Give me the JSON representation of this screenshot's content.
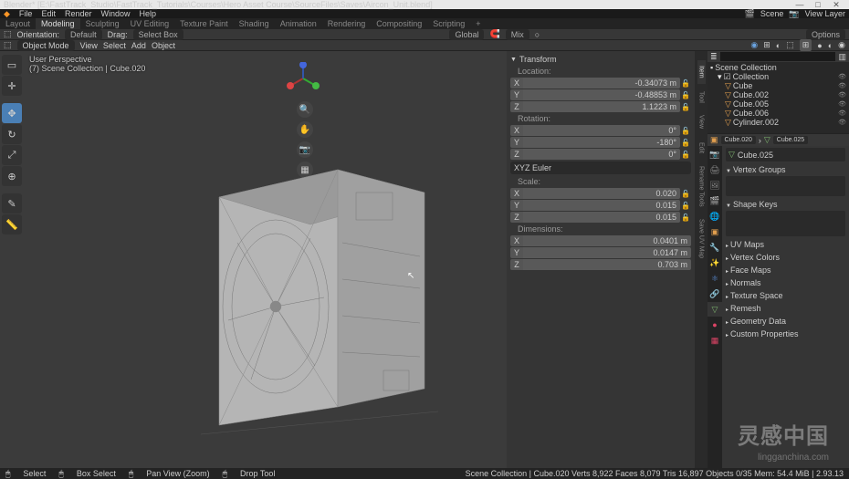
{
  "titlebar": {
    "title": "Blender* [E:\\FastTrack_Studio\\FastTrack_Tutorials\\Courses\\Hero Asset Course\\SourceFiles\\Saves\\Aircon_Unit.blend]"
  },
  "menubar": {
    "items": [
      "File",
      "Edit",
      "Render",
      "Window",
      "Help"
    ],
    "scene_label": "Scene",
    "viewlayer_label": "View Layer"
  },
  "workspaces": [
    "Layout",
    "Modeling",
    "Sculpting",
    "UV Editing",
    "Texture Paint",
    "Shading",
    "Animation",
    "Rendering",
    "Compositing",
    "Scripting",
    "+"
  ],
  "active_workspace": "Modeling",
  "header2": {
    "orientation": "Orientation:",
    "orientation_val": "Default",
    "drag": "Drag:",
    "drag_val": "Select Box",
    "global": "Global",
    "mix": "Mix",
    "options": "Options"
  },
  "header3": {
    "mode": "Object Mode",
    "menus": [
      "View",
      "Select",
      "Add",
      "Object"
    ]
  },
  "viewport": {
    "line1": "User Perspective",
    "line2": "(7) Scene Collection | Cube.020"
  },
  "transform_panel": {
    "title": "Transform",
    "location": "Location:",
    "loc": {
      "x": "-0.34073 m",
      "y": "-0.48853 m",
      "z": "1.1223 m"
    },
    "rotation": "Rotation:",
    "rot": {
      "x": "0°",
      "y": "-180°",
      "z": "0°"
    },
    "rotmode": "XYZ Euler",
    "scale": "Scale:",
    "scl": {
      "x": "0.020",
      "y": "0.015",
      "z": "0.015"
    },
    "dimensions": "Dimensions:",
    "dim": {
      "x": "0.0401 m",
      "y": "0.0147 m",
      "z": "0.703 m"
    }
  },
  "npanel_tabs": [
    "Item",
    "Tool",
    "View",
    "Edit",
    "Rename Tools",
    "Save UV Map"
  ],
  "outliner": {
    "root": "Scene Collection",
    "collection": "Collection",
    "items": [
      "Cube",
      "Cube.002",
      "Cube.005",
      "Cube.006",
      "Cylinder.002"
    ],
    "more": "...",
    "search_placeholder": ""
  },
  "props_breadcrumb": {
    "a": "Cube.020",
    "b": "Cube.025"
  },
  "props_name": "Cube.025",
  "props_sections": [
    "Vertex Groups",
    "Shape Keys",
    "UV Maps",
    "Vertex Colors",
    "Face Maps",
    "Normals",
    "Texture Space",
    "Remesh",
    "Geometry Data",
    "Custom Properties"
  ],
  "statusbar": {
    "left": [
      "Select",
      "Box Select",
      "Pan View (Zoom)",
      "Drop Tool"
    ],
    "right": "Scene Collection | Cube.020    Verts 8,922    Faces 8,079    Tris 16,897    Objects 0/35    Mem: 54.4 MiB | 2.93.13"
  },
  "watermark": {
    "a": "灵感中国",
    "b": "lingganchina.com"
  }
}
